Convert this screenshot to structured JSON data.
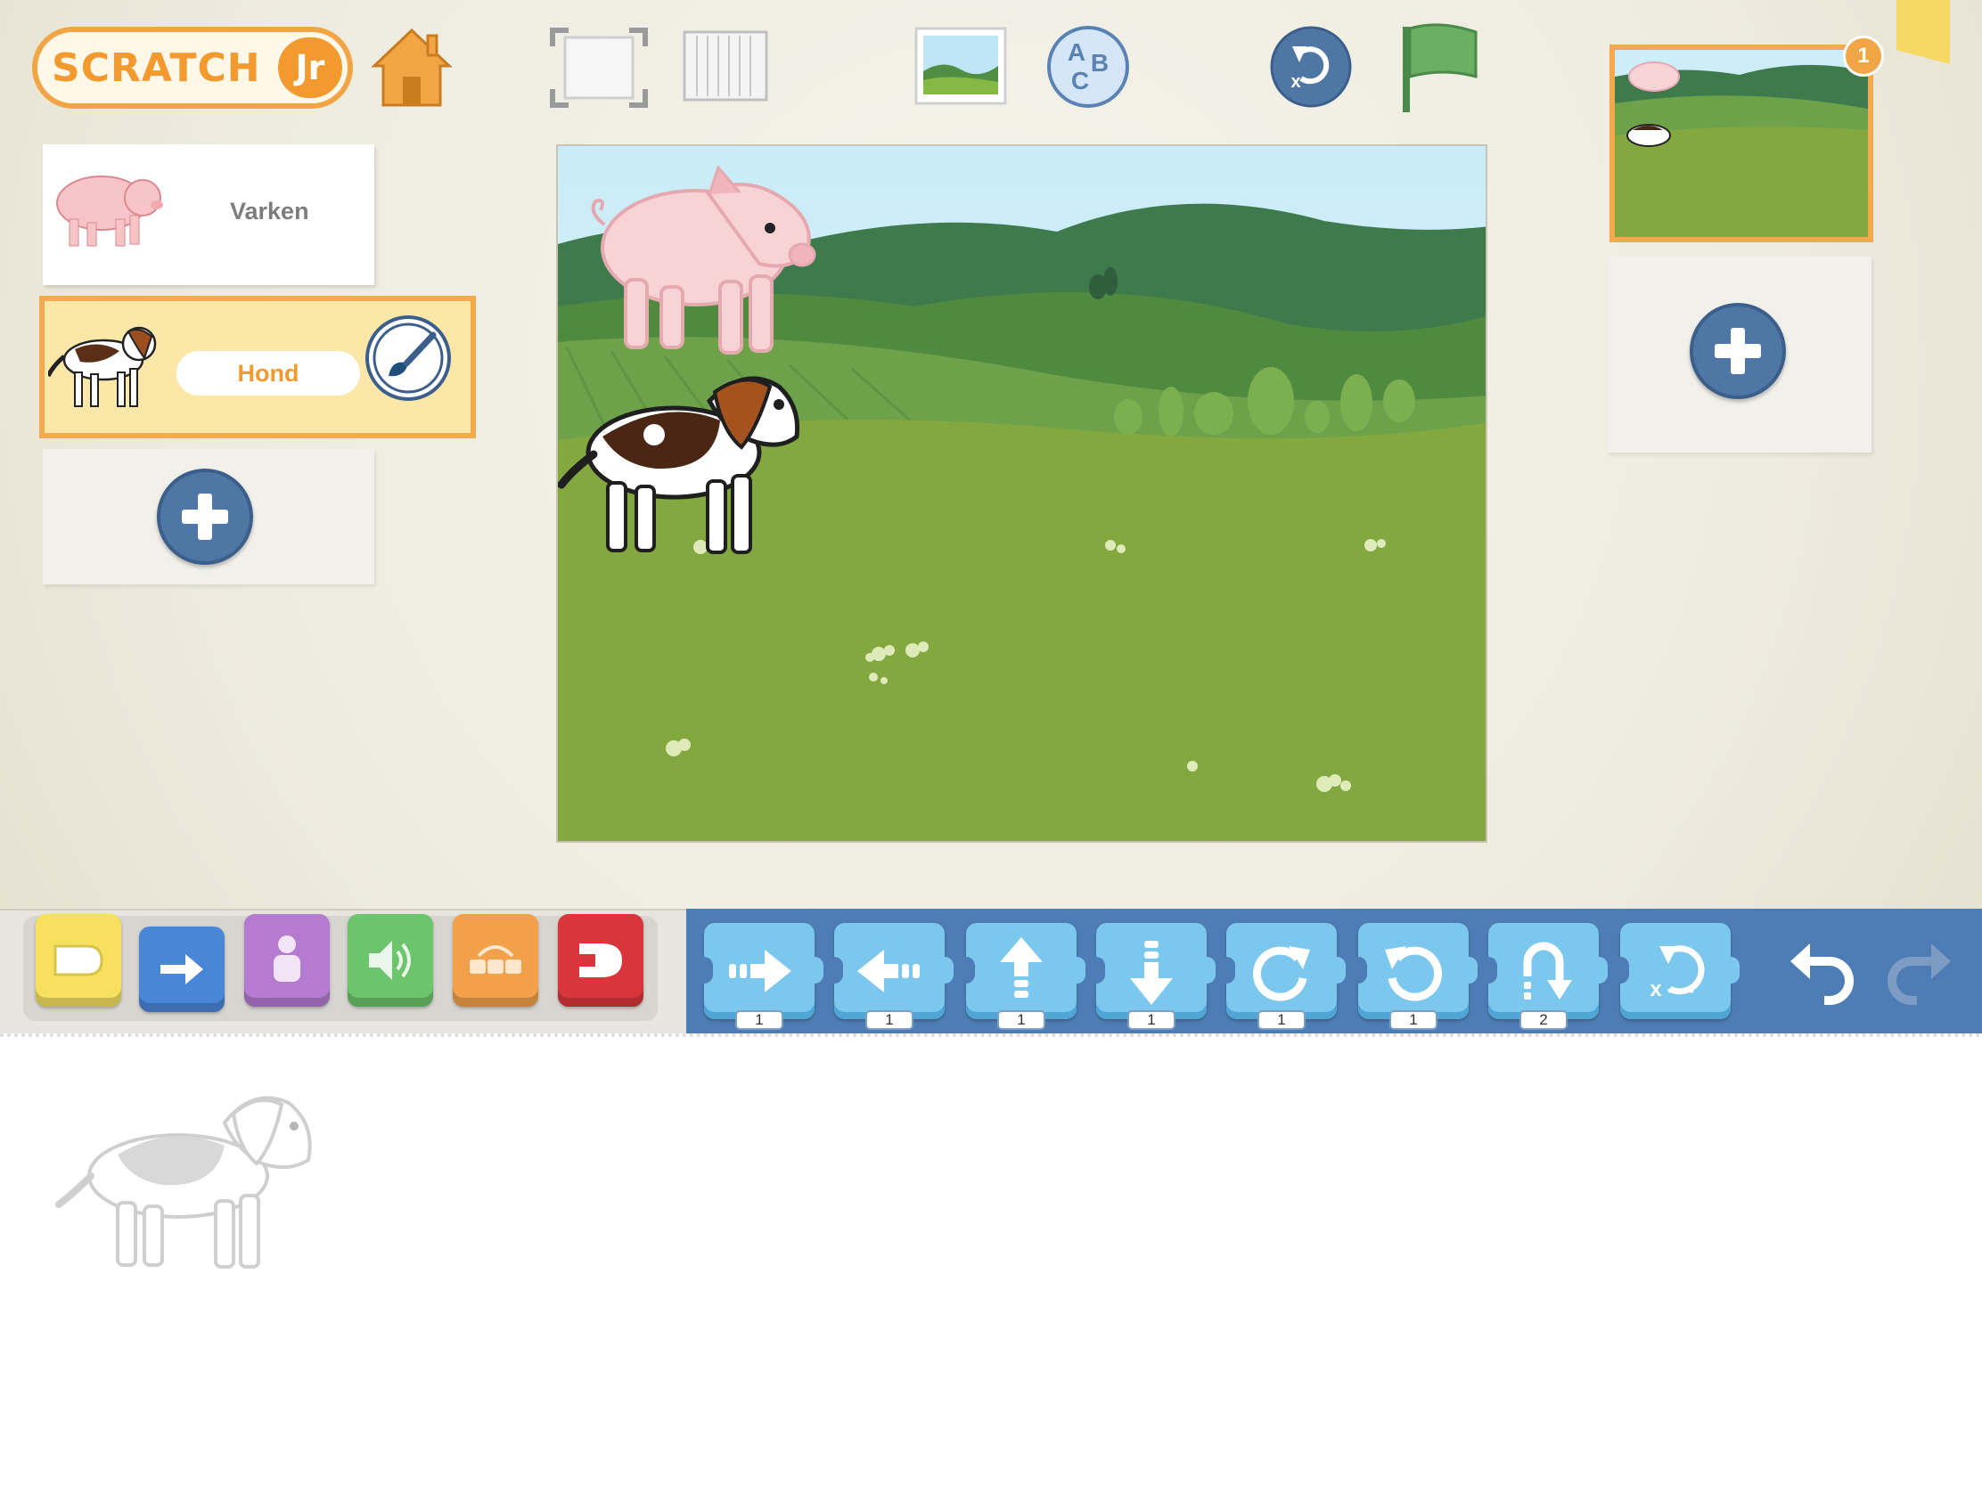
{
  "app": {
    "logo_text": "SCRATCH",
    "logo_suffix": "Jr"
  },
  "toolbar": {
    "home_icon": "home-icon",
    "fullscreen_icon": "fullscreen-icon",
    "grid_icon": "grid-icon",
    "background_icon": "background-picker-icon",
    "text_icon": "text-abc-icon",
    "text_letters": [
      "A",
      "B",
      "C"
    ],
    "reset_icon": "reset-characters-icon",
    "green_flag_icon": "green-flag-icon"
  },
  "sprites": [
    {
      "name": "Varken",
      "selected": false,
      "icon": "pig-icon"
    },
    {
      "name": "Hond",
      "selected": true,
      "icon": "dog-icon"
    }
  ],
  "pages": {
    "count_badge": "1",
    "items": [
      {
        "number": 1,
        "selected": true
      }
    ]
  },
  "categories": [
    {
      "id": "triggering",
      "color": "#f6e05e",
      "icon": "trigger-icon"
    },
    {
      "id": "motion",
      "color": "#4a86d8",
      "icon": "motion-arrow-icon"
    },
    {
      "id": "looks",
      "color": "#b47bd0",
      "icon": "looks-person-icon"
    },
    {
      "id": "sound",
      "color": "#6cc46c",
      "icon": "sound-speaker-icon"
    },
    {
      "id": "control",
      "color": "#f2a04a",
      "icon": "control-icon"
    },
    {
      "id": "end",
      "color": "#d8363a",
      "icon": "end-icon"
    }
  ],
  "motion_blocks": [
    {
      "id": "move-right",
      "icon": "move-right-icon",
      "value": "1"
    },
    {
      "id": "move-left",
      "icon": "move-left-icon",
      "value": "1"
    },
    {
      "id": "move-up",
      "icon": "move-up-icon",
      "value": "1"
    },
    {
      "id": "move-down",
      "icon": "move-down-icon",
      "value": "1"
    },
    {
      "id": "turn-right",
      "icon": "turn-right-icon",
      "value": "1"
    },
    {
      "id": "turn-left",
      "icon": "turn-left-icon",
      "value": "1"
    },
    {
      "id": "hop",
      "icon": "hop-icon",
      "value": "2"
    },
    {
      "id": "go-home",
      "icon": "go-home-icon",
      "value": ""
    }
  ],
  "edit": {
    "undo_icon": "undo-icon",
    "redo_icon": "redo-icon"
  },
  "script_area": {
    "watermark_icon": "dog-watermark-icon"
  }
}
